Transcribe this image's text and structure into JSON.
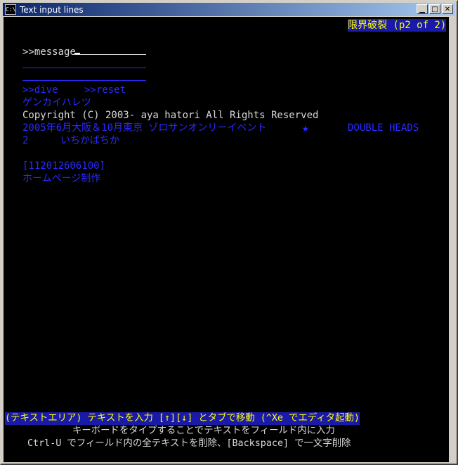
{
  "window": {
    "title": "Text input lines",
    "icon_text": "C:\\",
    "buttons": [
      "minimize-icon",
      "maximize-icon",
      "close-icon"
    ]
  },
  "header": {
    "title": "限界破裂 (p2 of 2)"
  },
  "content": {
    "input_prompt": ">>message",
    "links": {
      "dive": ">>dive",
      "reset": ">>reset"
    },
    "kana_title": "ゲンカイハレツ",
    "copyright": "Copyright (C) 2003- aya hatori All Rights Reserved",
    "event_line": "2005年6月大阪＆10月東京 ゾロサンオンリーイベント",
    "star": "★",
    "event_name": "DOUBLE HEADS",
    "number": "2",
    "author": "いちかばちか",
    "id_tag": "[112012606100]",
    "homepage": "ホームページ制作"
  },
  "status": {
    "line1": "(テキストエリア) テキストを入力 [↑][↓] とタブで移動 (^Xe でエディタ起動)",
    "line2": "キーボードをタイプすることでテキストをフィールド内に入力",
    "line3": "Ctrl-U でフィールド内の全テキストを削除、[Backspace] で一文字削除"
  },
  "colors": {
    "background": "#000000",
    "yellow": "#ffff00",
    "blue": "#2a2aff",
    "white": "#d8d8d8",
    "highlight": "#1a1aa8"
  }
}
